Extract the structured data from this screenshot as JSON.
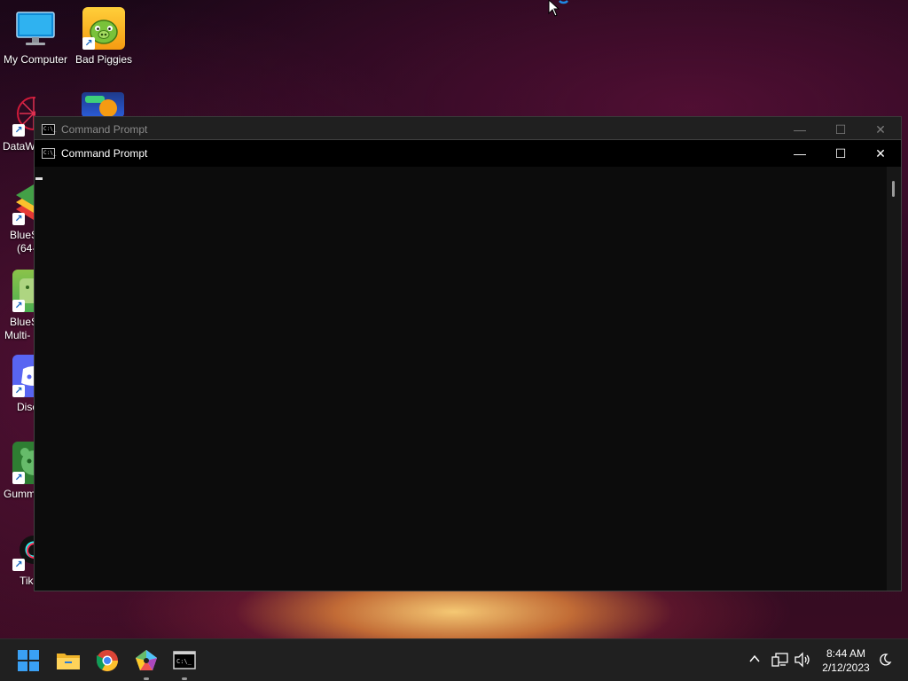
{
  "desktop": {
    "icons": [
      {
        "label": "My Computer",
        "icon": "monitor-icon"
      },
      {
        "label": "Bad Piggies",
        "icon": "bad-piggies-icon"
      },
      {
        "label": "DataW",
        "icon": "datawrapper-icon"
      },
      {
        "label": "BlueS",
        "label2": "(64-",
        "icon": "bluestacks-icon"
      },
      {
        "label": "BlueS",
        "label2": "Multi-",
        "icon": "bluestacks-multi-icon"
      },
      {
        "label": "Disc",
        "icon": "discord-icon"
      },
      {
        "label": "Gumm",
        "icon": "gummy-bear-icon"
      },
      {
        "label": "Tik",
        "icon": "tiktok-icon"
      }
    ]
  },
  "windows": {
    "back": {
      "title": "Command Prompt",
      "icon": "cmd-icon"
    },
    "front": {
      "title": "Command Prompt",
      "icon": "cmd-icon"
    },
    "cmd_icon_text": "C:\\_"
  },
  "taskbar": {
    "apps": [
      {
        "name": "Start",
        "icon": "windows-start-icon"
      },
      {
        "name": "File Explorer",
        "icon": "folder-icon"
      },
      {
        "name": "Google Chrome",
        "icon": "chrome-icon"
      },
      {
        "name": "Pentagon app",
        "icon": "pentagon-app-icon"
      },
      {
        "name": "Command Prompt",
        "icon": "terminal-icon"
      }
    ],
    "clock": {
      "time": "8:44 AM",
      "date": "2/12/2023"
    }
  },
  "colors": {
    "taskbar": "#202020",
    "console_bg": "#0c0c0c",
    "titlebar_active": "#000000"
  }
}
